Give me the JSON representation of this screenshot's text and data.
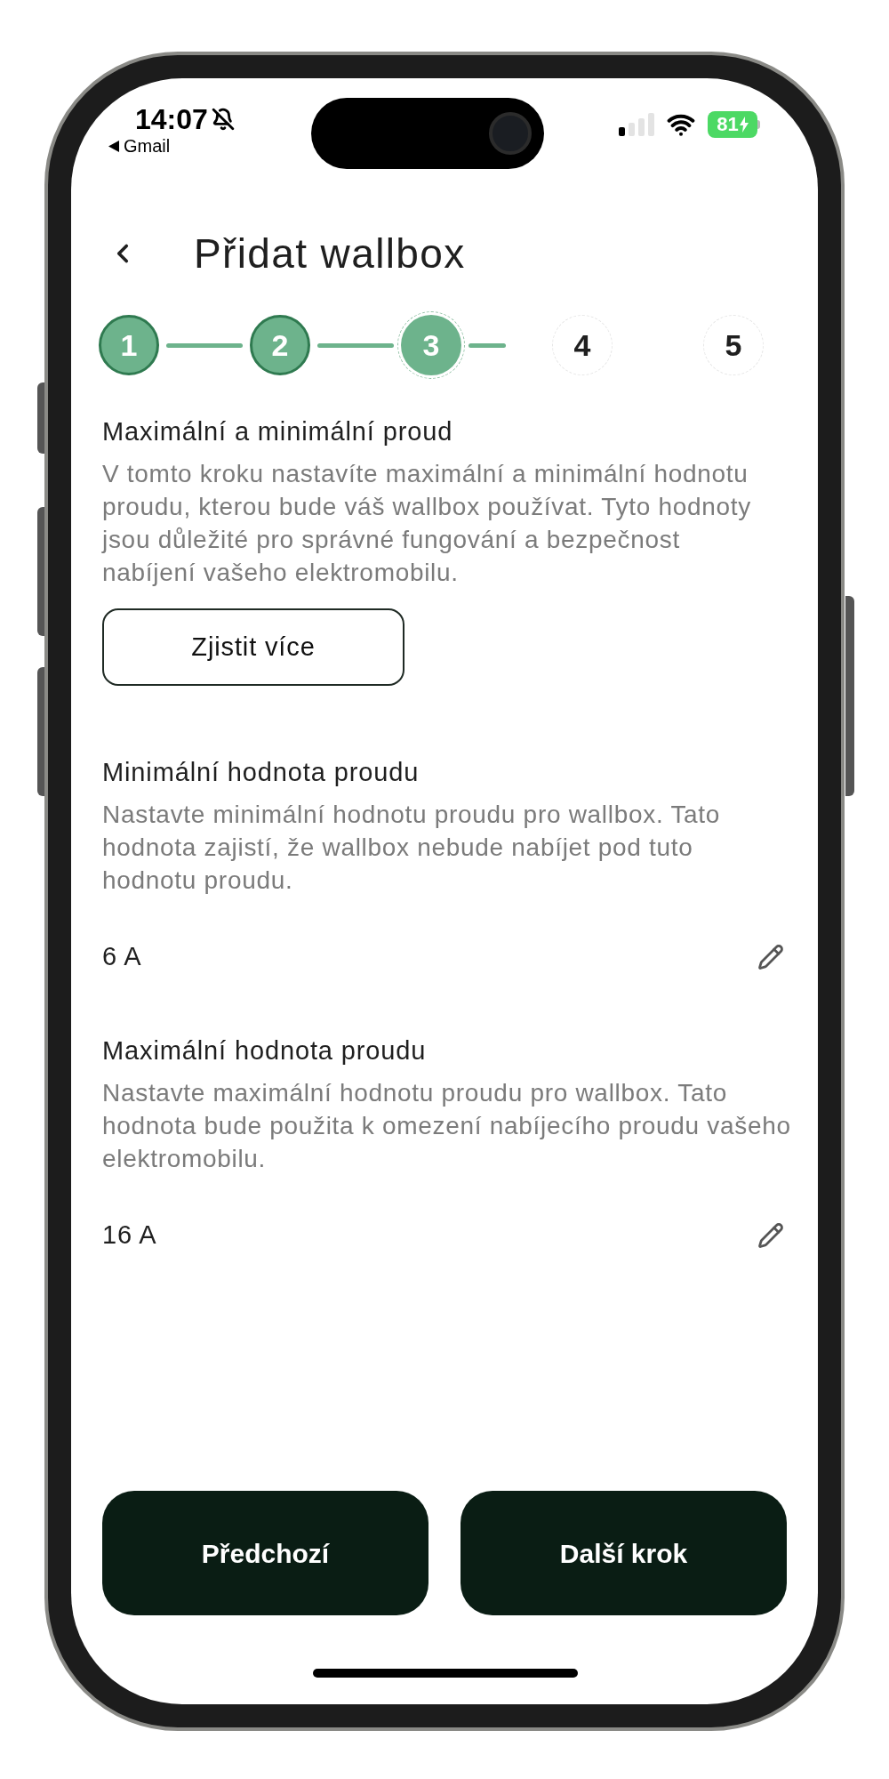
{
  "status_bar": {
    "time": "14:07",
    "silent": true,
    "back_app": "Gmail",
    "battery": "81",
    "charging": true
  },
  "header": {
    "title": "Přidat wallbox"
  },
  "stepper": [
    {
      "label": "1",
      "completed": true,
      "selected": false
    },
    {
      "label": "2",
      "completed": true,
      "selected": false
    },
    {
      "label": "3",
      "completed": false,
      "selected": true
    },
    {
      "label": "4",
      "completed": false,
      "selected": false
    },
    {
      "label": "5",
      "completed": false,
      "selected": false
    }
  ],
  "intro": {
    "title": "Maximální a minimální proud",
    "description": "V tomto kroku nastavíte maximální a minimální hodnotu proudu, kterou bude váš wallbox používat. Tyto hodnoty jsou důležité pro správné fungování a bezpečnost nabíjení vašeho elektromobilu.",
    "button": "Zjistit více"
  },
  "settings": [
    {
      "title": "Minimální hodnota proudu",
      "description": "Nastavte minimální hodnotu proudu pro wallbox. Tato hodnota zajistí, že wallbox nebude nabíjet pod tuto hodnotu proudu.",
      "value": "6 A"
    },
    {
      "title": "Maximální hodnota proudu",
      "description": "Nastavte maximální hodnotu proudu pro wallbox. Tato hodnota bude použita k omezení nabíjecího proudu vašeho elektromobilu.",
      "value": "16 A"
    }
  ],
  "footer_buttons": [
    {
      "label": "Předchozí"
    },
    {
      "label": "Další krok"
    }
  ]
}
